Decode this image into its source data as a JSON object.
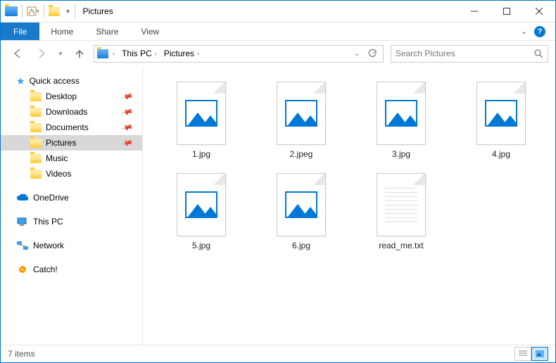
{
  "window": {
    "title": "Pictures"
  },
  "ribbon": {
    "file": "File",
    "tabs": [
      "Home",
      "Share",
      "View"
    ]
  },
  "breadcrumbs": [
    "This PC",
    "Pictures"
  ],
  "search": {
    "placeholder": "Search Pictures"
  },
  "sidebar": {
    "quick_access": {
      "label": "Quick access"
    },
    "quick_items": [
      {
        "label": "Desktop",
        "pinned": true
      },
      {
        "label": "Downloads",
        "pinned": true
      },
      {
        "label": "Documents",
        "pinned": true
      },
      {
        "label": "Pictures",
        "pinned": true,
        "selected": true
      },
      {
        "label": "Music",
        "pinned": false
      },
      {
        "label": "Videos",
        "pinned": false
      }
    ],
    "roots": [
      {
        "label": "OneDrive",
        "icon": "cloud"
      },
      {
        "label": "This PC",
        "icon": "pc"
      },
      {
        "label": "Network",
        "icon": "network"
      },
      {
        "label": "Catch!",
        "icon": "catch"
      }
    ]
  },
  "files": [
    {
      "name": "1.jpg",
      "type": "image"
    },
    {
      "name": "2.jpeg",
      "type": "image"
    },
    {
      "name": "3.jpg",
      "type": "image"
    },
    {
      "name": "4.jpg",
      "type": "image"
    },
    {
      "name": "5.jpg",
      "type": "image"
    },
    {
      "name": "6.jpg",
      "type": "image"
    },
    {
      "name": "read_me.txt",
      "type": "text"
    }
  ],
  "status": {
    "count": "7 items"
  }
}
